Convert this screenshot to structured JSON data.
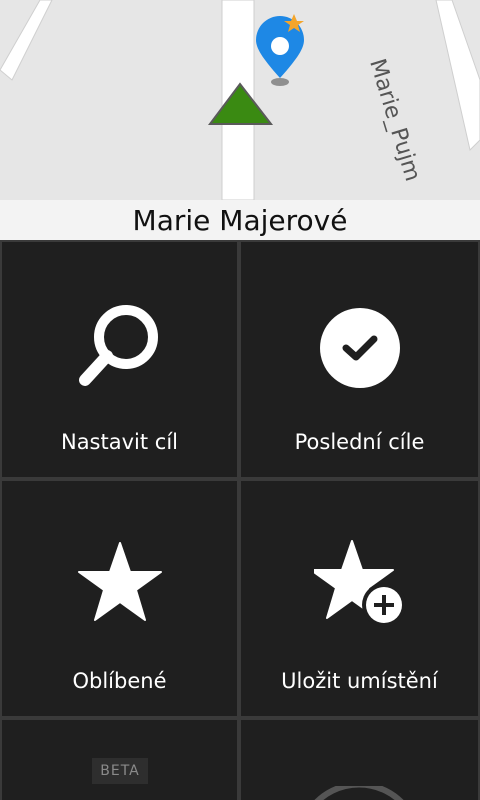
{
  "map": {
    "street_name": "Marie Majerové",
    "side_street": "Marie_Pujm"
  },
  "menu": {
    "tiles": [
      {
        "label": "Nastavit cíl",
        "icon": "search-icon"
      },
      {
        "label": "Poslední cíle",
        "icon": "check-circle-icon"
      },
      {
        "label": "Oblíbené",
        "icon": "star-icon"
      },
      {
        "label": "Uložit umístění",
        "icon": "star-add-icon"
      }
    ],
    "beta_label": "BETA"
  },
  "colors": {
    "tile_bg": "#1f1f1f",
    "map_bg": "#e6e6e6",
    "arrow_green": "#3a8a12",
    "pin_blue": "#1e88e5",
    "pin_star": "#f4a52a"
  }
}
